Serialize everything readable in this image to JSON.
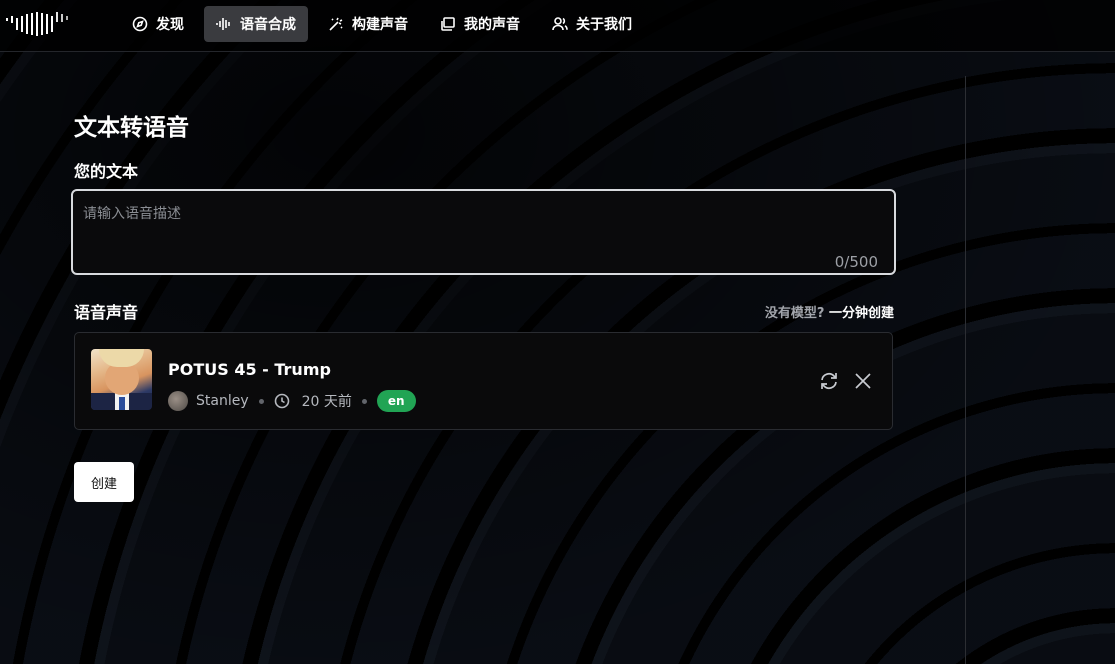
{
  "nav": {
    "items": [
      {
        "label": "发现",
        "icon": "compass-icon",
        "active": false
      },
      {
        "label": "语音合成",
        "icon": "audio-waveform-icon",
        "active": true
      },
      {
        "label": "构建声音",
        "icon": "magic-wand-icon",
        "active": false
      },
      {
        "label": "我的声音",
        "icon": "folder-icon",
        "active": false
      },
      {
        "label": "关于我们",
        "icon": "users-icon",
        "active": false
      }
    ]
  },
  "main": {
    "title": "文本转语音",
    "text_label": "您的文本",
    "text_placeholder": "请输入语音描述",
    "text_value": "",
    "counter": "0/500",
    "voice_label": "语音声音",
    "no_model_text": "没有模型?",
    "create_link": "一分钟创建",
    "voice": {
      "name": "POTUS 45 - Trump",
      "author": "Stanley",
      "time": "20 天前",
      "language": "en"
    },
    "create_button": "创建"
  },
  "colors": {
    "accent_green": "#21a454",
    "active_nav_bg": "#3a3b3f",
    "background": "#000000"
  }
}
